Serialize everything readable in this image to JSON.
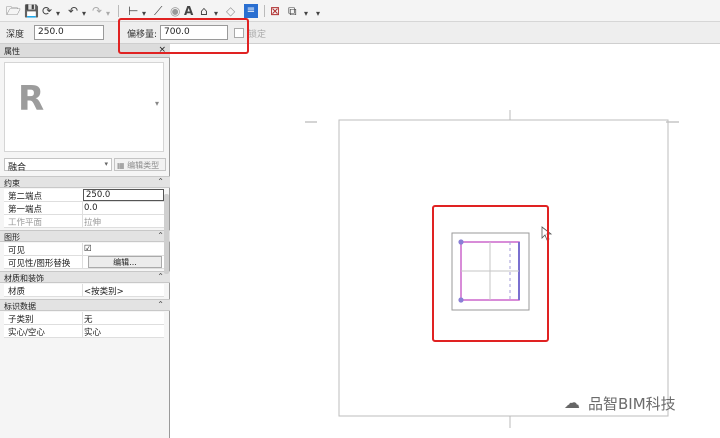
{
  "options_bar": {
    "depth_label": "深度",
    "depth_value": "250.0",
    "offset_label": "偏移量:",
    "offset_value": "700.0",
    "lock_label": "锁定"
  },
  "properties": {
    "title": "属性",
    "close_glyph": "×",
    "preview_logo": "R",
    "type_selector": "融合",
    "edit_type_label": "编辑类型",
    "sections": {
      "constraints": "约束",
      "graphics": "图形",
      "materials": "材质和装饰",
      "identity": "标识数据"
    },
    "rows": {
      "second_end_label": "第二端点",
      "second_end_value": "250.0",
      "first_end_label": "第一端点",
      "first_end_value": "0.0",
      "work_plane_label": "工作平面",
      "work_plane_value": "拉伸",
      "visible_label": "可见",
      "visible_value": "☑",
      "visibility_override_label": "可见性/图形替换",
      "visibility_override_button": "编辑...",
      "material_label": "材质",
      "material_value": "<按类别>",
      "subcategory_label": "子类别",
      "subcategory_value": "无",
      "solid_void_label": "实心/空心",
      "solid_void_value": "实心"
    }
  },
  "watermark": {
    "text": "品智BIM科技"
  },
  "colors": {
    "highlight": "#e02222",
    "sketch": "#cc66cc",
    "reference": "#8a7fd6"
  }
}
